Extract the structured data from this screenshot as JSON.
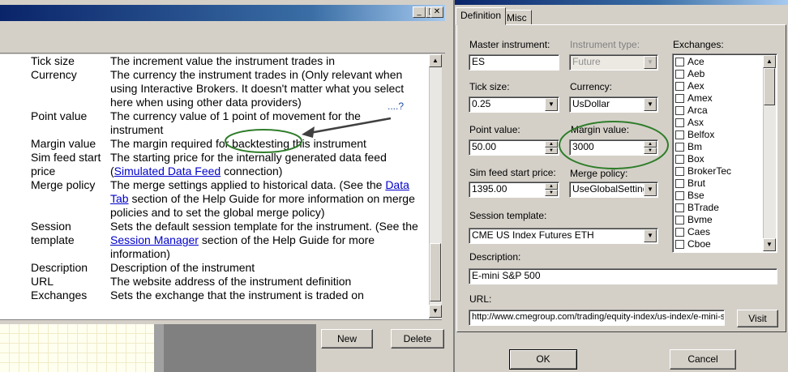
{
  "help_window": {
    "title_buttons": {
      "minimize": "_",
      "maximize": "□",
      "close": "✕"
    },
    "rows": [
      {
        "term": "Tick size",
        "desc": "The increment value the instrument trades in"
      },
      {
        "term": "Currency",
        "desc": "The currency the instrument trades in (Only relevant when using Interactive Brokers. It doesn't matter what you select here when using other data providers)"
      },
      {
        "term": "Point value",
        "desc": "The currency value of 1 point of movement for the instrument"
      },
      {
        "term": "Margin value",
        "desc": "The margin required for backtesting this instrument"
      },
      {
        "term": "Sim feed start price",
        "desc_pre": "The starting price for the internally generated data feed (",
        "desc_link": "Simulated Data Feed",
        "desc_post": " connection)"
      },
      {
        "term": "Merge policy",
        "desc_pre": "The merge settings applied to historical data. (See the ",
        "desc_link": "Data Tab",
        "desc_post": " section of the Help Guide for more information on merge policies and to set the global merge policy)"
      },
      {
        "term": "Session template",
        "desc_pre": "Sets the default session template for the instrument. (See the ",
        "desc_link": "Session Manager",
        "desc_post": " section of the Help Guide for more information)"
      },
      {
        "term": "Description",
        "desc": "Description of the instrument"
      },
      {
        "term": "URL",
        "desc": "The website address of the instrument definition"
      },
      {
        "term": "Exchanges",
        "desc": "Sets the exchange that the instrument is traded on"
      }
    ],
    "annotation_text": "....?",
    "buttons": {
      "new": "New",
      "delete": "Delete"
    }
  },
  "instrument_editor": {
    "tabs": [
      "Definition",
      "Misc"
    ],
    "master_instrument": {
      "label": "Master instrument:",
      "value": "ES"
    },
    "instrument_type": {
      "label": "Instrument type:",
      "value": "Future"
    },
    "tick_size": {
      "label": "Tick size:",
      "value": "0.25"
    },
    "currency": {
      "label": "Currency:",
      "value": "UsDollar"
    },
    "point_value": {
      "label": "Point value:",
      "value": "50.00"
    },
    "margin_value": {
      "label": "Margin value:",
      "value": "3000"
    },
    "sim_feed_start_price": {
      "label": "Sim feed start price:",
      "value": "1395.00"
    },
    "merge_policy": {
      "label": "Merge policy:",
      "value": "UseGlobalSettings"
    },
    "session_template": {
      "label": "Session template:",
      "value": "CME US Index Futures ETH"
    },
    "description": {
      "label": "Description:",
      "value": "E-mini S&P 500"
    },
    "url": {
      "label": "URL:",
      "value": "http://www.cmegroup.com/trading/equity-index/us-index/e-mini-s&"
    },
    "visit_label": "Visit",
    "exchanges": {
      "label": "Exchanges:",
      "items": [
        "Ace",
        "Aeb",
        "Aex",
        "Amex",
        "Arca",
        "Asx",
        "Belfox",
        "Bm",
        "Box",
        "BrokerTec",
        "Brut",
        "Bse",
        "BTrade",
        "Bvme",
        "Caes",
        "Cboe"
      ]
    },
    "ok_label": "OK",
    "cancel_label": "Cancel"
  },
  "colors": {
    "annotation_green": "#2f7d2a",
    "link": "#0000cc",
    "titlebar": "#0a246a"
  }
}
